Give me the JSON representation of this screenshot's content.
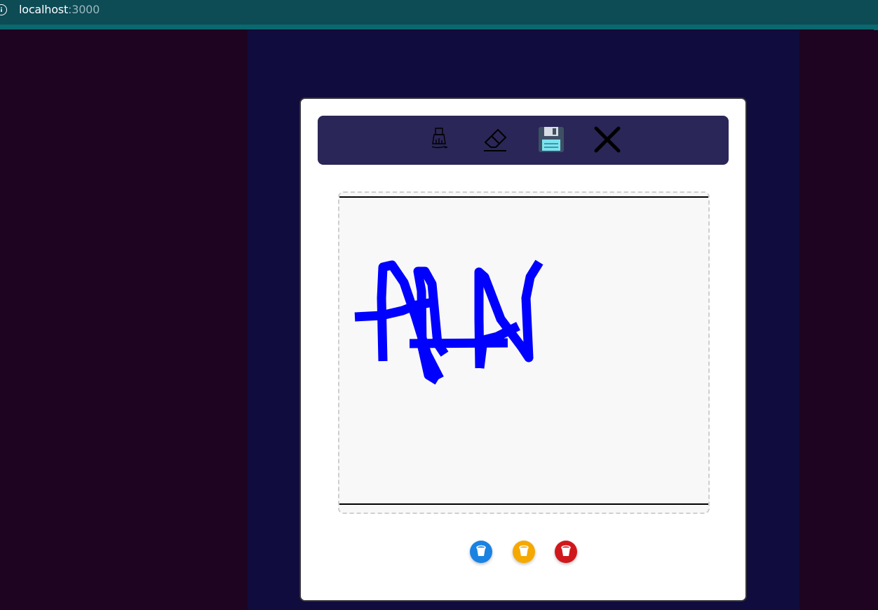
{
  "browser": {
    "url_host": "localhost",
    "url_port": ":3000",
    "info_icon": "info-icon"
  },
  "toolbar": {
    "tools": [
      {
        "name": "brush-icon"
      },
      {
        "name": "eraser-icon"
      },
      {
        "name": "save-icon"
      },
      {
        "name": "close-icon"
      }
    ]
  },
  "canvas": {
    "stroke_color": "#0000ff",
    "background": "#f8f8f8"
  },
  "palette": {
    "colors": [
      {
        "name": "blue-bucket-icon",
        "color": "#1a82e2"
      },
      {
        "name": "yellow-bucket-icon",
        "color": "#f5a800"
      },
      {
        "name": "red-bucket-icon",
        "color": "#d0181c"
      }
    ]
  }
}
